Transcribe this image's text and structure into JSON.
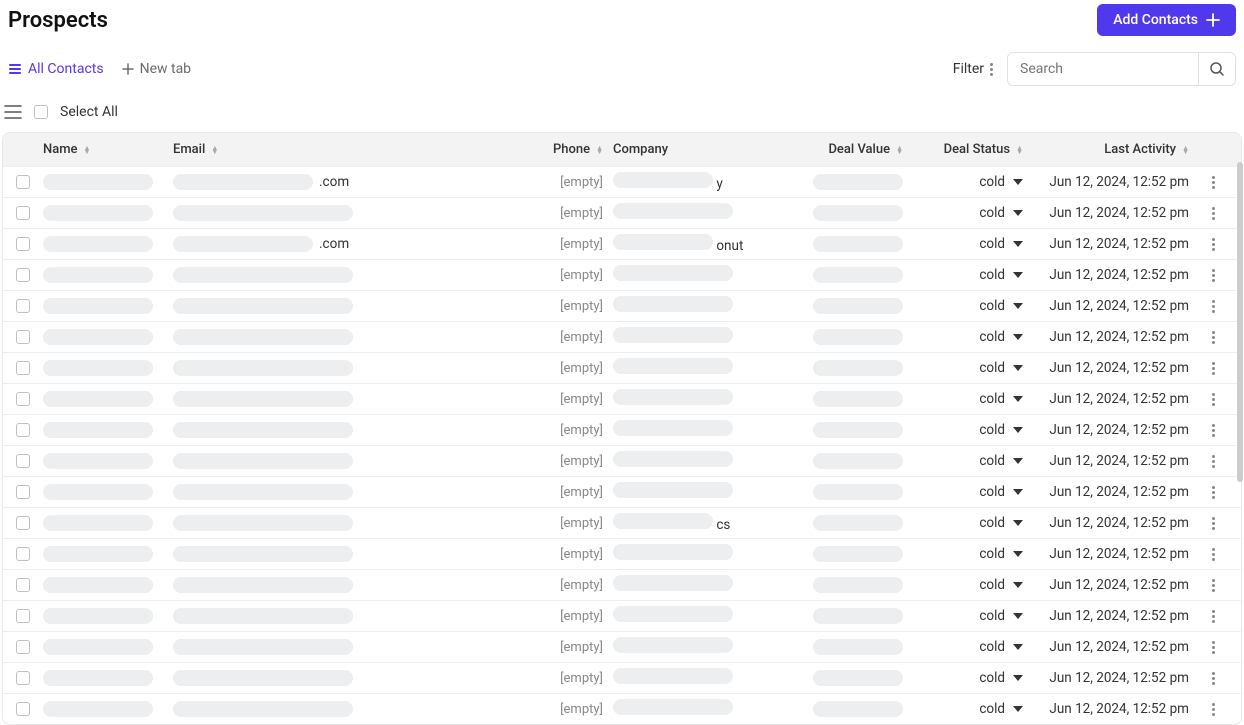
{
  "header": {
    "title": "Prospects",
    "addButton": "Add Contacts"
  },
  "tabs": {
    "active": "All Contacts",
    "newTab": "New tab"
  },
  "toolbar": {
    "filter": "Filter",
    "searchPlaceholder": "Search",
    "selectAll": "Select All"
  },
  "columns": {
    "name": "Name",
    "email": "Email",
    "phone": "Phone",
    "company": "Company",
    "dealValue": "Deal Value",
    "dealStatus": "Deal Status",
    "lastActivity": "Last Activity"
  },
  "common": {
    "empty": "[empty]",
    "status": "cold",
    "activity": "Jun 12, 2024, 12:52 pm"
  },
  "rows": [
    {
      "emailSuffix": ".com",
      "companySuffix": "y"
    },
    {
      "emailSuffix": "",
      "companySuffix": ""
    },
    {
      "emailSuffix": ".com",
      "companySuffix": "onut"
    },
    {
      "emailSuffix": "",
      "companySuffix": ""
    },
    {
      "emailSuffix": "",
      "companySuffix": ""
    },
    {
      "emailSuffix": "",
      "companySuffix": ""
    },
    {
      "emailSuffix": "",
      "companySuffix": ""
    },
    {
      "emailSuffix": "",
      "companySuffix": ""
    },
    {
      "emailSuffix": "",
      "companySuffix": ""
    },
    {
      "emailSuffix": "",
      "companySuffix": ""
    },
    {
      "emailSuffix": "",
      "companySuffix": ""
    },
    {
      "emailSuffix": "",
      "companySuffix": "cs"
    },
    {
      "emailSuffix": "",
      "companySuffix": ""
    },
    {
      "emailSuffix": "",
      "companySuffix": ""
    },
    {
      "emailSuffix": "",
      "companySuffix": ""
    },
    {
      "emailSuffix": "",
      "companySuffix": ""
    },
    {
      "emailSuffix": "",
      "companySuffix": ""
    },
    {
      "emailSuffix": "",
      "companySuffix": ""
    }
  ]
}
